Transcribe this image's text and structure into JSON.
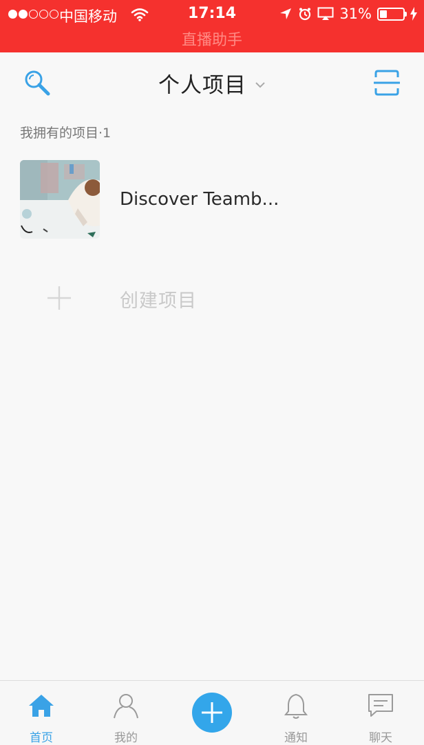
{
  "status_bar": {
    "carrier": "中国移动",
    "time": "17:14",
    "battery": "31%",
    "battery_level": 0.31,
    "banner": "直播助手",
    "signal_bars_on": 2,
    "signal_bars_total": 5
  },
  "header": {
    "title": "个人项目",
    "search_icon": "search-icon",
    "scan_icon": "scan-icon"
  },
  "section": {
    "label": "我拥有的项目·1"
  },
  "projects": [
    {
      "name": "Discover Teamb..."
    }
  ],
  "create": {
    "label": "创建项目"
  },
  "tab_bar": {
    "tabs": [
      {
        "label": "首页",
        "icon": "home-icon",
        "active": true
      },
      {
        "label": "我的",
        "icon": "user-icon",
        "active": false
      },
      {
        "label": "通知",
        "icon": "bell-icon",
        "active": false
      },
      {
        "label": "聊天",
        "icon": "chat-icon",
        "active": false
      }
    ],
    "fab_icon": "plus-icon"
  },
  "colors": {
    "status_bar": "#f5312e",
    "accent": "#33a6ea",
    "background": "#f8f8f8"
  }
}
